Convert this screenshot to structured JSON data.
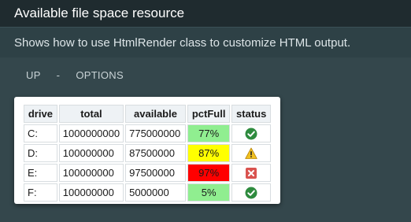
{
  "header": {
    "title": "Available file space resource"
  },
  "subheader": {
    "text": "Shows how to use HtmlRender class to customize HTML output."
  },
  "nav": {
    "up_label": "UP",
    "separator": "-",
    "options_label": "OPTIONS"
  },
  "table": {
    "columns": [
      "drive",
      "total",
      "available",
      "pctFull",
      "status"
    ],
    "rows": [
      {
        "drive": "C:",
        "total": "1000000000",
        "available": "775000000",
        "pctFull": "77%",
        "pct_color": "#90ee90",
        "status_icon": "check-icon"
      },
      {
        "drive": "D:",
        "total": "100000000",
        "available": "87500000",
        "pctFull": "87%",
        "pct_color": "#ffff00",
        "status_icon": "warning-icon"
      },
      {
        "drive": "E:",
        "total": "100000000",
        "available": "97500000",
        "pctFull": "97%",
        "pct_color": "#ff0000",
        "status_icon": "error-icon"
      },
      {
        "drive": "F:",
        "total": "100000000",
        "available": "5000000",
        "pctFull": "5%",
        "pct_color": "#90ee90",
        "status_icon": "check-icon"
      }
    ]
  },
  "colors": {
    "ok": "#2e8b3e",
    "warning": "#f0c020",
    "error": "#d9534f"
  }
}
